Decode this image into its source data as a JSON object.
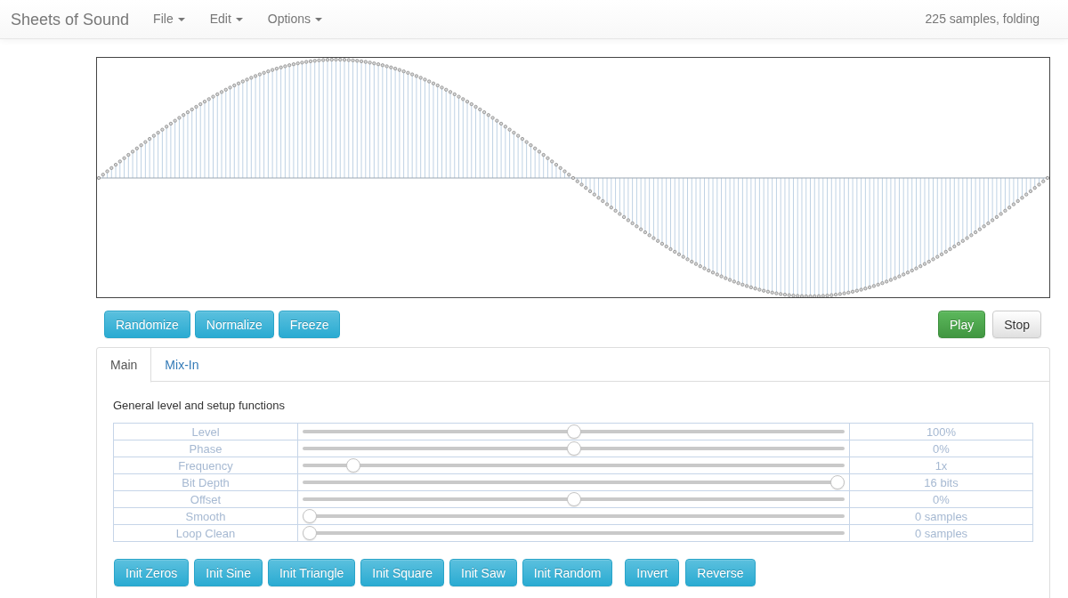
{
  "navbar": {
    "brand": "Sheets of Sound",
    "menus": [
      {
        "label": "File"
      },
      {
        "label": "Edit"
      },
      {
        "label": "Options"
      }
    ],
    "status": "225 samples, folding"
  },
  "wave_actions": [
    "Randomize",
    "Normalize",
    "Freeze"
  ],
  "transport": [
    {
      "label": "Play",
      "kind": "success"
    },
    {
      "label": "Stop",
      "kind": "default"
    }
  ],
  "tabs": [
    {
      "label": "Main",
      "selected": true
    },
    {
      "label": "Mix-In",
      "selected": false
    }
  ],
  "section_title": "General level and setup functions",
  "parameters": [
    {
      "name": "Level",
      "level": 0.5,
      "reading": "100%"
    },
    {
      "name": "Phase",
      "level": 0.5,
      "reading": "0%"
    },
    {
      "name": "Frequency",
      "level": 0.083,
      "reading": "1x"
    },
    {
      "name": "Bit Depth",
      "level": 1,
      "reading": "16 bits"
    },
    {
      "name": "Offset",
      "level": 0.5,
      "reading": "0%"
    },
    {
      "name": "Smooth",
      "level": 0,
      "reading": "0 samples"
    },
    {
      "name": "Loop Clean",
      "level": 0,
      "reading": "0 samples"
    }
  ],
  "init_buttons": [
    "Init Zeros",
    "Init Sine",
    "Init Triangle",
    "Init Square",
    "Init Saw",
    "Init Random"
  ],
  "edit_buttons": [
    "Invert",
    "Reverse"
  ]
}
